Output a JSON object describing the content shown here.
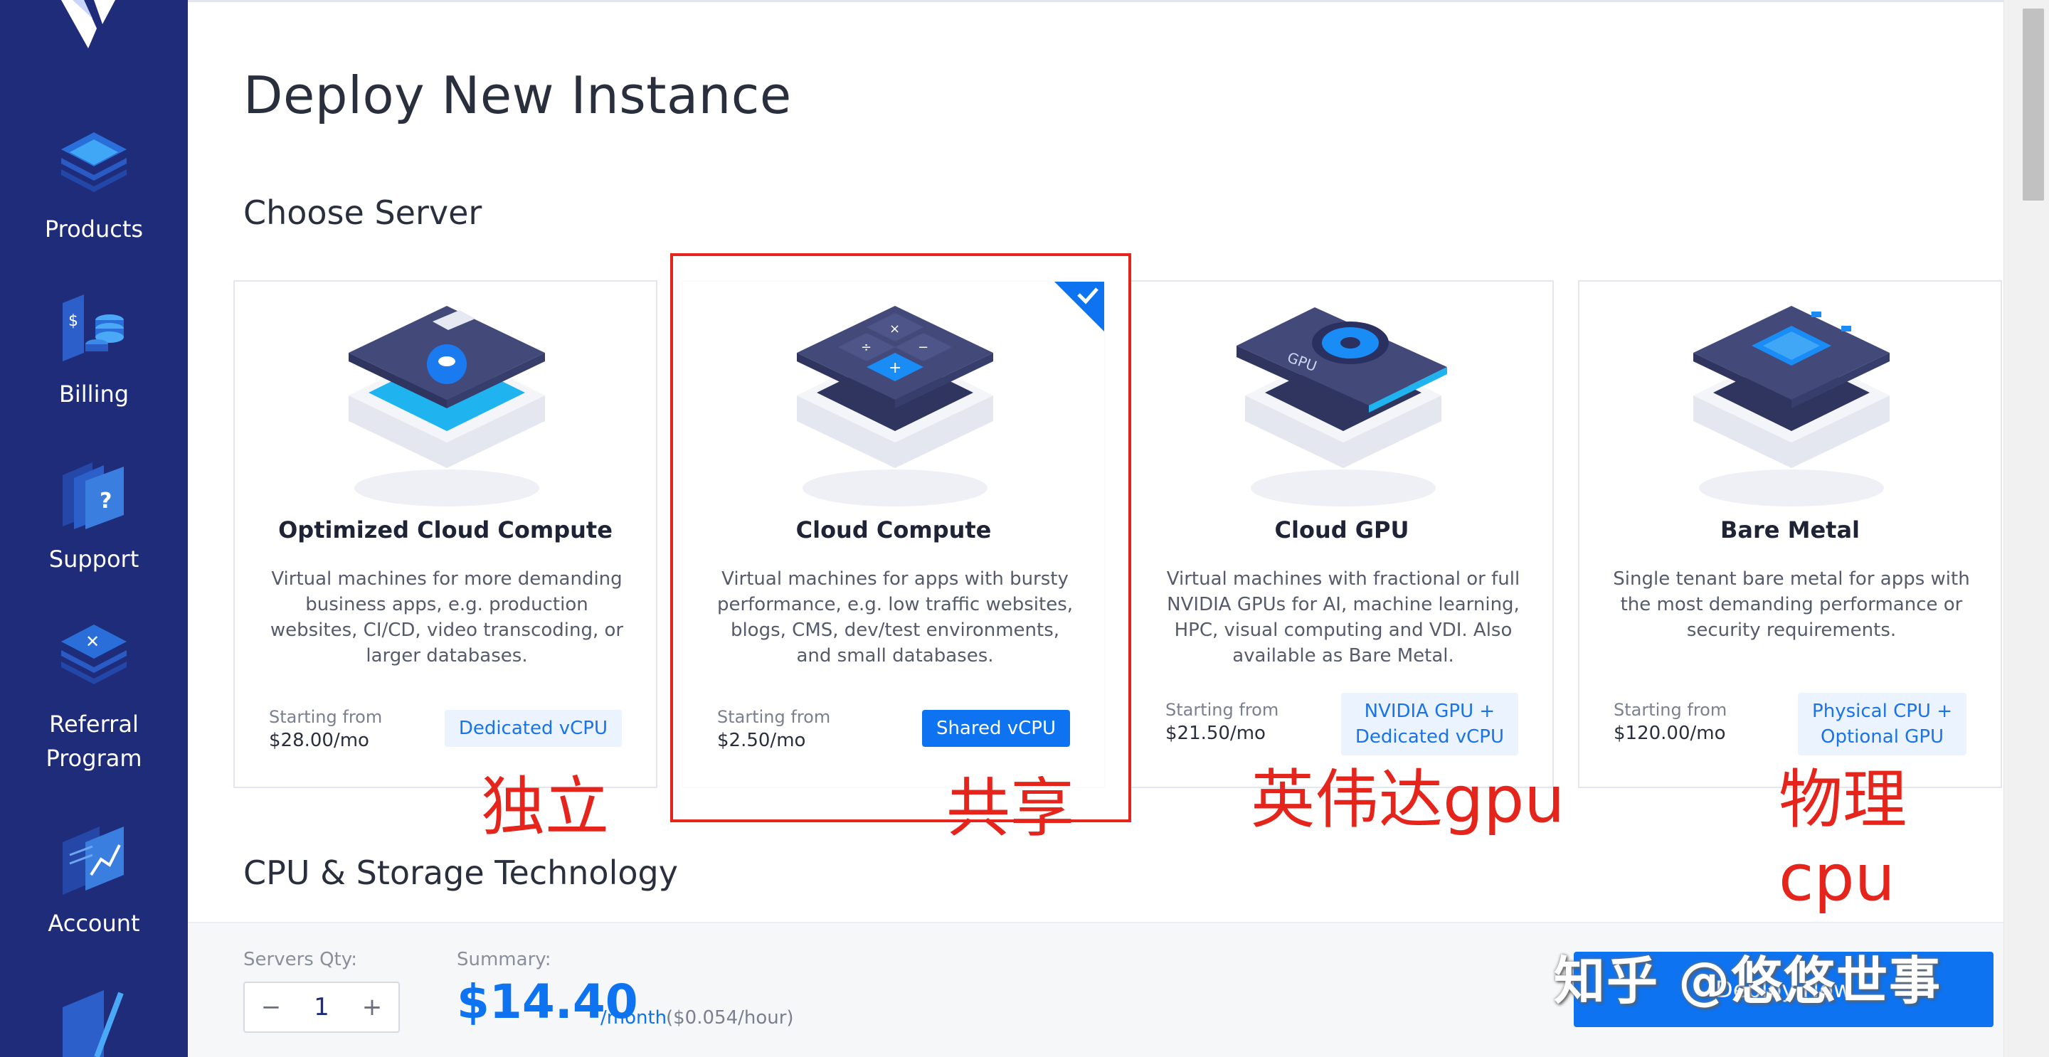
{
  "sidebar": {
    "items": [
      {
        "label": "Products",
        "icon": "products-stack-icon"
      },
      {
        "label": "Billing",
        "icon": "billing-coins-icon"
      },
      {
        "label": "Support",
        "icon": "support-question-icon"
      },
      {
        "label": "Referral\nProgram",
        "icon": "referral-stack-icon"
      },
      {
        "label": "Account",
        "icon": "account-chart-icon"
      },
      {
        "label": "",
        "icon": "pen-document-icon"
      }
    ]
  },
  "main": {
    "title": "Deploy New Instance",
    "section_choose": "Choose Server",
    "section_cpu": "CPU & Storage Technology",
    "cards": [
      {
        "title": "Optimized Cloud Compute",
        "desc": "Virtual machines for more demanding business apps, e.g. production websites, CI/CD, video transcoding, or larger databases.",
        "from_label": "Starting from",
        "price": "$28.00/mo",
        "badge": "Dedicated vCPU",
        "selected": false
      },
      {
        "title": "Cloud Compute",
        "desc": "Virtual machines for apps with bursty performance, e.g. low traffic websites, blogs, CMS, dev/test environments, and small databases.",
        "from_label": "Starting from",
        "price": "$2.50/mo",
        "badge": "Shared vCPU",
        "selected": true
      },
      {
        "title": "Cloud GPU",
        "desc": "Virtual machines with fractional or full NVIDIA GPUs for AI, machine learning, HPC, visual computing and VDI. Also available as Bare Metal.",
        "from_label": "Starting from",
        "price": "$21.50/mo",
        "badge": "NVIDIA GPU +\nDedicated vCPU",
        "selected": false
      },
      {
        "title": "Bare Metal",
        "desc": "Single tenant bare metal for apps with the most demanding performance or security requirements.",
        "from_label": "Starting from",
        "price": "$120.00/mo",
        "badge": "Physical CPU +\nOptional GPU",
        "selected": false
      }
    ]
  },
  "annotations": {
    "a1": "独立",
    "a2": "共享",
    "a3": "英伟达gpu",
    "a4": "物理\ncpu"
  },
  "footer": {
    "qty_label": "Servers Qty:",
    "qty_value": "1",
    "minus": "−",
    "plus": "+",
    "summary_label": "Summary:",
    "price": "$14.40",
    "per_month": "/month",
    "per_hour": "($0.054/hour)",
    "deploy_label": "Deploy Now",
    "watermark": "知乎 @悠悠世事"
  },
  "colors": {
    "sidebar": "#1e2c7a",
    "accent": "#0e73f0",
    "annotation_red": "#e5241b"
  }
}
